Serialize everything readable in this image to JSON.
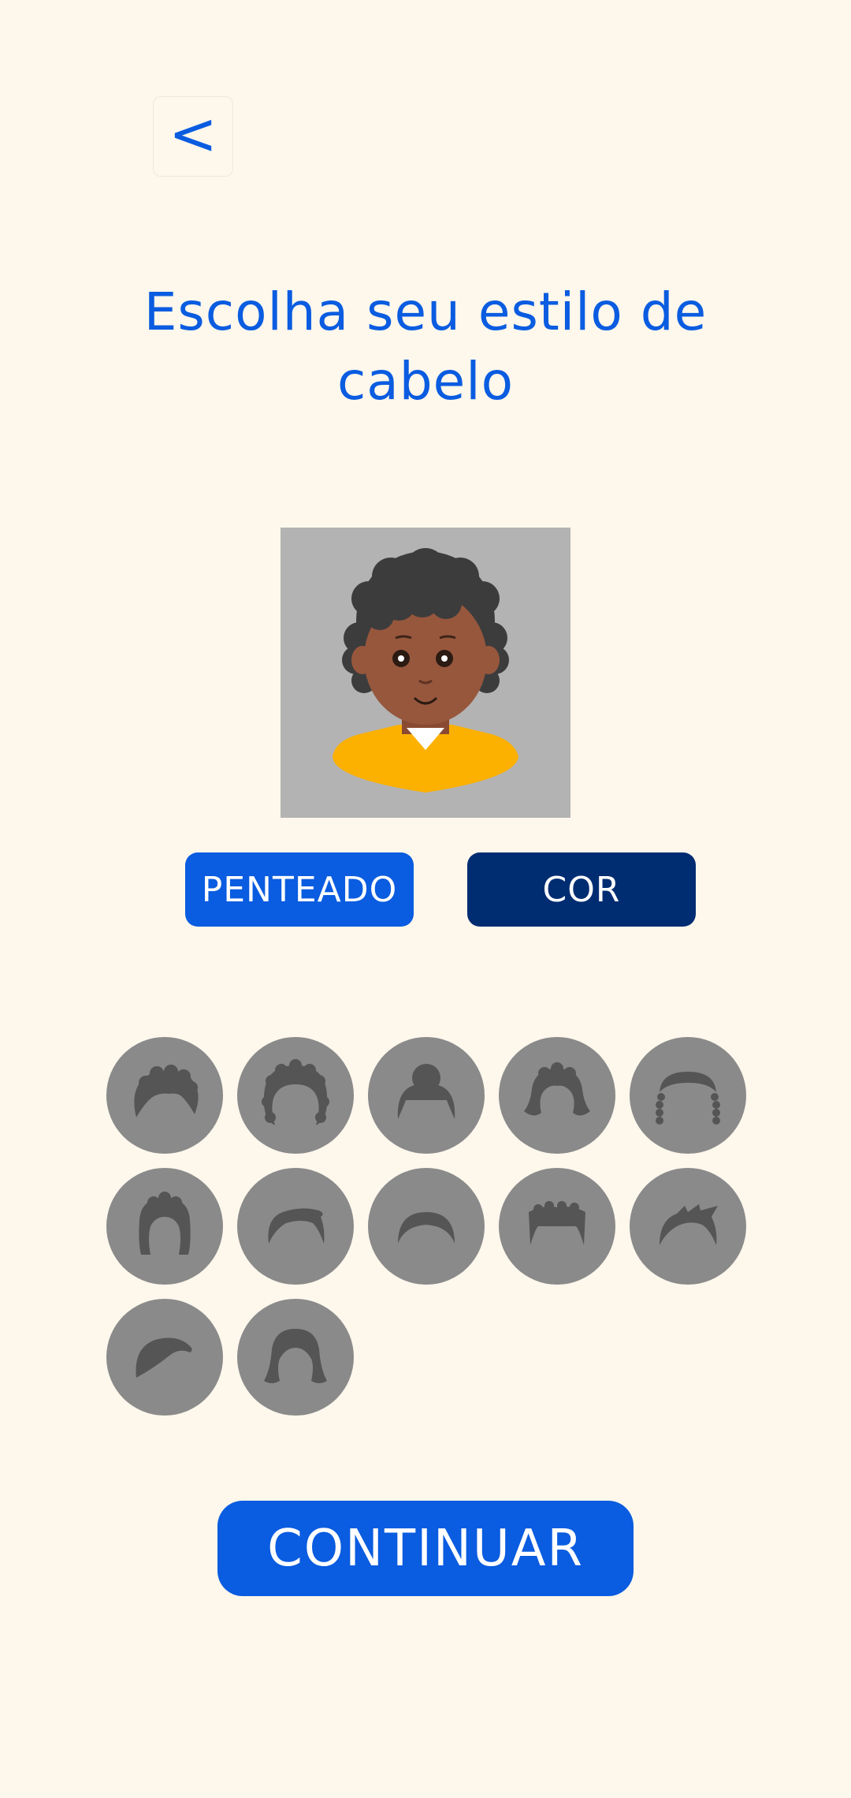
{
  "back": {
    "label": "<"
  },
  "title": "Escolha seu estilo de cabelo",
  "tabs": [
    {
      "label": "PENTEADO"
    },
    {
      "label": "COR"
    }
  ],
  "continue_label": "CONTINUAR",
  "colors": {
    "background": "#fdf7ec",
    "accent": "#0a5ce0",
    "tab_inactive": "#002c72",
    "option_bg": "#8a8a8a",
    "option_icon": "#555555",
    "preview_bg": "#b3b3b3"
  },
  "hair_options": [
    {
      "icon": "curly-short-hair-icon"
    },
    {
      "icon": "afro-hair-icon"
    },
    {
      "icon": "bun-hair-icon"
    },
    {
      "icon": "curly-bob-hair-icon"
    },
    {
      "icon": "braids-hair-icon"
    },
    {
      "icon": "long-curly-hair-icon"
    },
    {
      "icon": "swept-short-hair-icon"
    },
    {
      "icon": "buzz-cut-hair-icon"
    },
    {
      "icon": "flat-top-hair-icon"
    },
    {
      "icon": "spiky-hair-icon"
    },
    {
      "icon": "side-part-hair-icon"
    },
    {
      "icon": "long-straight-hair-icon"
    }
  ]
}
